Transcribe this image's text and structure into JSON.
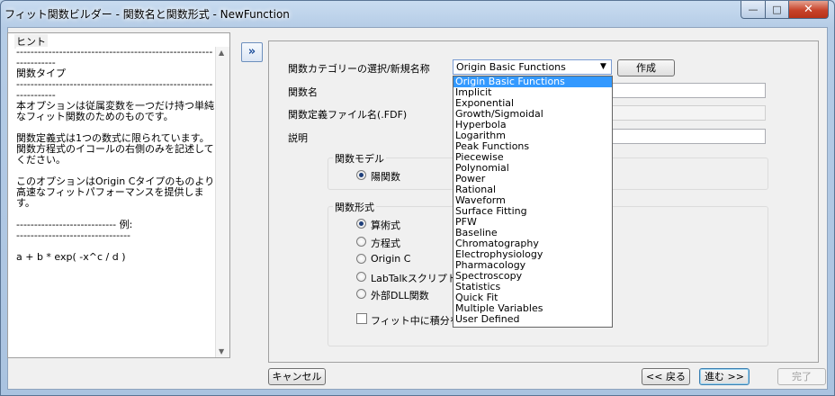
{
  "window": {
    "title": "フィット関数ビルダー - 関数名と関数形式 - NewFunction",
    "min_glyph": "—",
    "max_glyph": "□",
    "close_glyph": "✕"
  },
  "hint": {
    "title": "ヒント",
    "body": "------------------------------------------------------------------\n関数タイプ\n------------------------------------------------------------------\n本オプションは従属変数を一つだけ持つ単純なフィット関数のためのものです。\n\n関数定義式は1つの数式に限られています。関数方程式のイコールの右側のみを記述してください。\n\nこのオプションはOrigin Cタイプのものより高速なフィットパフォーマンスを提供します。\n\n---------------------------- 例:\n--------------------------------\n\na + b * exp( -x^c / d )"
  },
  "expand_button": "»",
  "form": {
    "category_label": "関数カテゴリーの選択/新規名称",
    "category_value": "Origin Basic Functions",
    "create_button": "作成",
    "name_label": "関数名",
    "file_label": "関数定義ファイル名(.FDF)",
    "desc_label": "説明"
  },
  "model_group": {
    "title": "関数モデル",
    "options": [
      "陽関数"
    ],
    "selected": 0
  },
  "form_group": {
    "title": "関数形式",
    "options": [
      "算術式",
      "方程式",
      "Origin C",
      "LabTalkスクリプト",
      "外部DLL関数"
    ],
    "selected": 0,
    "checkbox_label": "フィット中に積分を"
  },
  "dropdown": {
    "items": [
      "Origin Basic Functions",
      "Implicit",
      "Exponential",
      "Growth/Sigmoidal",
      "Hyperbola",
      "Logarithm",
      "Peak Functions",
      "Piecewise",
      "Polynomial",
      "Power",
      "Rational",
      "Waveform",
      "Surface Fitting",
      "PFW",
      "Baseline",
      "Chromatography",
      "Electrophysiology",
      "Pharmacology",
      "Spectroscopy",
      "Statistics",
      "Quick Fit",
      "Multiple Variables",
      "User Defined"
    ],
    "selected_index": 0
  },
  "footer": {
    "cancel": "キャンセル",
    "back": "<< 戻る",
    "next": "進む >>",
    "finish": "完了"
  }
}
